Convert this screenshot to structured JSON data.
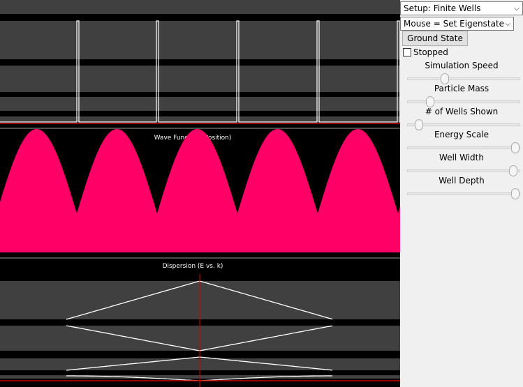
{
  "panel": {
    "setup_select": "Setup: Finite Wells",
    "mouse_select": "Mouse = Set Eigenstate",
    "ground_button": "Ground State",
    "stopped_label": "Stopped",
    "stopped_checked": false,
    "sliders": [
      {
        "label": "Simulation Speed",
        "value": 0.32
      },
      {
        "label": "Particle Mass",
        "value": 0.18
      },
      {
        "label": "# of Wells Shown",
        "value": 0.07
      },
      {
        "label": "Energy Scale",
        "value": 0.99
      },
      {
        "label": "Well Width",
        "value": 0.97
      },
      {
        "label": "Well Depth",
        "value": 0.99
      }
    ]
  },
  "sim": {
    "wavefunction_title": "Wave Function (Position)",
    "dispersion_title": "Dispersion (E vs. k)",
    "wave_color": "#ff0066",
    "curve_color": "#ffffff",
    "marker_color": "#d00000",
    "band_color": "#404040"
  }
}
